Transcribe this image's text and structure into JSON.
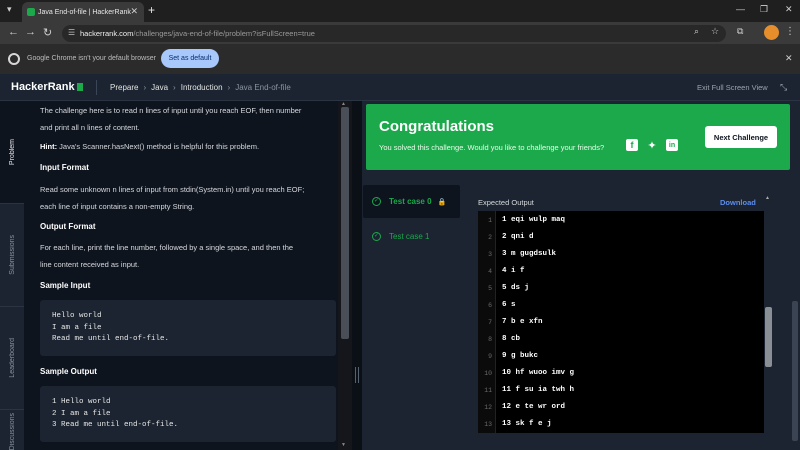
{
  "browser": {
    "tab_title": "Java End-of-file | HackerRank",
    "tab_close": "✕",
    "new_tab": "+",
    "url_host": "hackerrank.com",
    "url_path": "/challenges/java-end-of-file/problem?isFullScreen=true"
  },
  "infobar": {
    "message": "Google Chrome isn't your default browser",
    "button": "Set as default"
  },
  "header": {
    "logo": "HackerRank",
    "breadcrumbs": [
      "Prepare",
      "Java",
      "Introduction",
      "Java End-of-file"
    ],
    "exit_fullscreen": "Exit Full Screen View"
  },
  "rail": {
    "tabs": [
      "Problem",
      "Submissions",
      "Leaderboard",
      "Discussions"
    ]
  },
  "problem": {
    "intro_line1": "The challenge here is to read n lines of input until you reach EOF, then number",
    "intro_line2": "and print all n lines of content.",
    "hint_label": "Hint:",
    "hint_text": " Java's Scanner.hasNext() method is helpful for this problem.",
    "input_format_title": "Input Format",
    "input_line1": "Read some unknown n lines of input from stdin(System.in) until you reach EOF;",
    "input_line2": "each line of input contains a non-empty String.",
    "output_format_title": "Output Format",
    "output_line1": "For each line, print the line number, followed by a single space, and then the",
    "output_line2": "line content received as input.",
    "sample_input_title": "Sample Input",
    "sample_input": [
      "Hello world",
      "I am a file",
      "Read me until end-of-file."
    ],
    "sample_output_title": "Sample Output",
    "sample_output": [
      "1 Hello world",
      "2 I am a file",
      "3 Read me until end-of-file."
    ]
  },
  "result": {
    "title": "Congratulations",
    "subtitle": "You solved this challenge. Would you like to challenge your friends?",
    "next_button": "Next Challenge",
    "test_cases": [
      "Test case 0",
      "Test case 1"
    ],
    "expected_output_label": "Expected Output",
    "download_label": "Download",
    "output_lines": [
      {
        "n": "1",
        "text": "1 eqi wulp maq"
      },
      {
        "n": "2",
        "text": "2 qni d"
      },
      {
        "n": "3",
        "text": "3 m gugdsulk"
      },
      {
        "n": "4",
        "text": "4 i f"
      },
      {
        "n": "5",
        "text": "5 ds j"
      },
      {
        "n": "6",
        "text": "6 s"
      },
      {
        "n": "7",
        "text": "7 b e xfn"
      },
      {
        "n": "8",
        "text": "8 cb"
      },
      {
        "n": "9",
        "text": "9 g bukc"
      },
      {
        "n": "10",
        "text": "10 hf wuoo imv g"
      },
      {
        "n": "11",
        "text": "11 f su ia twh h"
      },
      {
        "n": "12",
        "text": "12 e te wr ord"
      },
      {
        "n": "13",
        "text": "13 sk f e j"
      }
    ]
  },
  "colors": {
    "accent_green": "#1ba94c",
    "background": "#0e141e",
    "panel": "#1b2430",
    "link_blue": "#5b8def"
  }
}
